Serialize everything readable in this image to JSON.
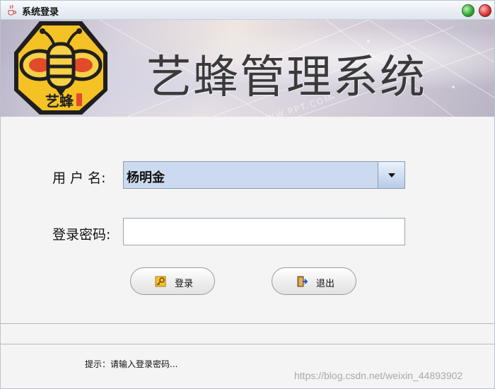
{
  "window": {
    "title": "系统登录",
    "app_icon": "java-cup-icon"
  },
  "titlebar_buttons": {
    "minimize_icon": "green-circle-icon",
    "close_icon": "red-circle-icon"
  },
  "banner": {
    "logo_text": "艺蜂",
    "title": "艺蜂管理系统",
    "watermark_text": "WWW.PPT.COM"
  },
  "form": {
    "username_label": "用 户 名:",
    "username_value": "杨明金",
    "password_label": "登录密码:",
    "password_value": ""
  },
  "buttons": {
    "login_label": "登录",
    "login_icon": "key-icon",
    "exit_label": "退出",
    "exit_icon": "exit-door-icon"
  },
  "status": {
    "hint": "提示：请输入登录密码..."
  },
  "watermark": "https://blog.csdn.net/weixin_44893902"
}
